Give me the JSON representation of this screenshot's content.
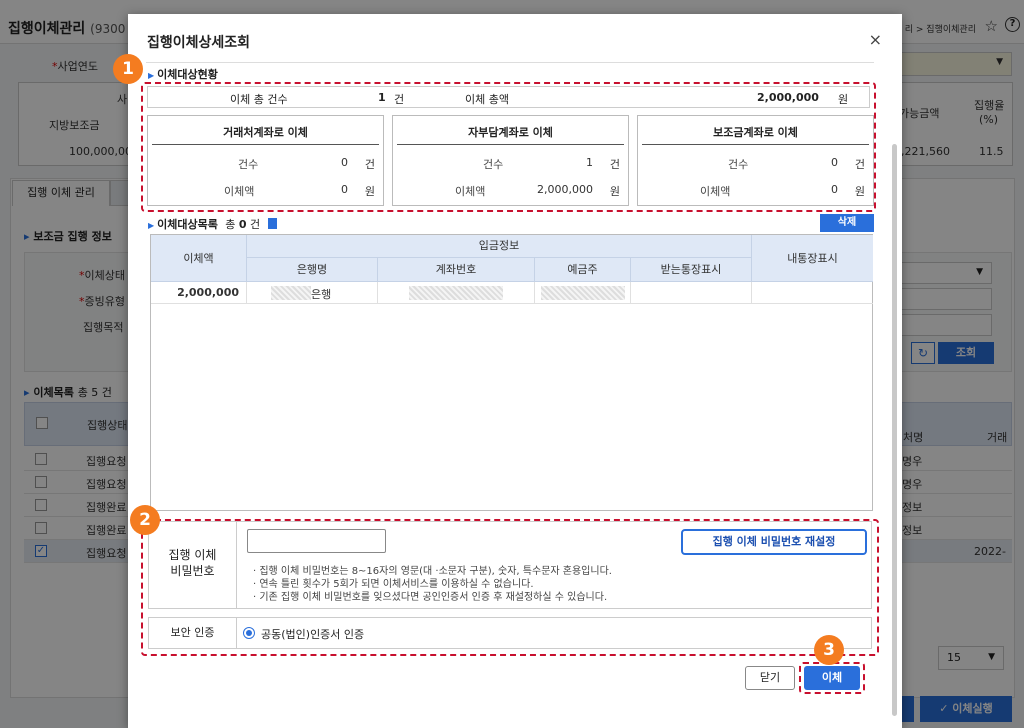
{
  "background": {
    "title": "집행이체관리",
    "title_code": "(9300",
    "breadcrumb": "리 > 집행이체관리",
    "year_label": "사업연도",
    "summary_head_1": "사",
    "summary_head_2": "가능금액",
    "summary_head_3": "집행율",
    "summary_head_3b": "(%)",
    "summary_row_label": "지방보조금",
    "summary_amount": "100,000,00",
    "summary_avail": "88,221,560",
    "summary_rate": "11.5",
    "tab_label": "집행 이체 관리",
    "section_info": "보조금 집행 정보",
    "field_status": "이체상태",
    "field_proof": "증빙유형",
    "field_purpose": "집행목적",
    "search_label": "조회",
    "list_title": "이체목록",
    "list_count_text": "총 5 건",
    "col_status": "집행상태",
    "col_name": "처명",
    "col_extra": "거래",
    "rows": [
      {
        "status": "집행요청",
        "name": "명우",
        "extra": ""
      },
      {
        "status": "집행요청",
        "name": "명우",
        "extra": ""
      },
      {
        "status": "집행완료",
        "name": "정보",
        "extra": ""
      },
      {
        "status": "집행완료",
        "name": "정보",
        "extra": ""
      },
      {
        "status": "집행요청",
        "name": "",
        "extra": "2022-"
      }
    ],
    "page_size": "15",
    "exec_button": "이체실행"
  },
  "modal": {
    "title": "집행이체상세조회",
    "close_icon": "×",
    "section1_title": "이체대상현황",
    "total_count_label": "이체 총 건수",
    "total_count_value": "1",
    "total_count_unit": "건",
    "total_amount_label": "이체 총액",
    "total_amount_value": "2,000,000",
    "total_amount_unit": "원",
    "boxes": [
      {
        "title": "거래처계좌로 이체",
        "count_label": "건수",
        "count": "0",
        "count_unit": "건",
        "amount_label": "이체액",
        "amount": "0",
        "amount_unit": "원"
      },
      {
        "title": "자부담계좌로 이체",
        "count_label": "건수",
        "count": "1",
        "count_unit": "건",
        "amount_label": "이체액",
        "amount": "2,000,000",
        "amount_unit": "원"
      },
      {
        "title": "보조금계좌로 이체",
        "count_label": "건수",
        "count": "0",
        "count_unit": "건",
        "amount_label": "이체액",
        "amount": "0",
        "amount_unit": "원"
      }
    ],
    "section2_title": "이체대상목록",
    "section2_count_prefix": "총",
    "section2_count": "0",
    "section2_count_unit": "건",
    "delete_button": "삭제",
    "grid": {
      "col_amount": "이체액",
      "col_group": "입금정보",
      "col_bank": "은행명",
      "col_account": "계좌번호",
      "col_holder": "예금주",
      "col_recv_memo": "받는통장표시",
      "col_my_memo": "내통장표시",
      "rows": [
        {
          "amount": "2,000,000",
          "bank_suffix": "은행"
        }
      ]
    },
    "pw_label_1": "집행 이체",
    "pw_label_2": "비밀번호",
    "pw_value": "",
    "pw_reset_button": "집행 이체 비밀번호 재설정",
    "pw_notes": [
      "· 집행 이체 비밀번호는 8~16자의 영문(대 ·소문자 구분), 숫자, 특수문자 혼용입니다.",
      "· 연속 틀린 횟수가 5회가 되면 이체서비스를 이용하실 수 없습니다.",
      "· 기존 집행 이체 비밀번호를 잊으셨다면 공인인증서 인증 후 재설정하실 수 있습니다."
    ],
    "auth_label": "보안 인증",
    "auth_option": "공동(법인)인증서 인증",
    "close_button": "닫기",
    "transfer_button": "이체"
  },
  "annotations": {
    "badge_1": "1",
    "badge_2": "2",
    "badge_3": "3",
    "dash_color": "#c8102e",
    "badge_color": "#f47c20"
  },
  "colors": {
    "accent": "#2a6fdb",
    "grid_header": "#dfe8f6"
  }
}
